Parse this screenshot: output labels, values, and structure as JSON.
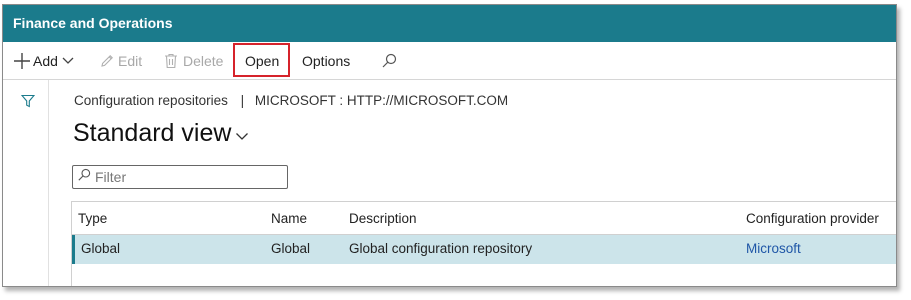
{
  "app": {
    "title": "Finance and Operations"
  },
  "toolbar": {
    "add_label": "Add",
    "edit_label": "Edit",
    "delete_label": "Delete",
    "open_label": "Open",
    "options_label": "Options"
  },
  "breadcrumb": {
    "page": "Configuration repositories",
    "separator": "|",
    "record": "MICROSOFT : HTTP://MICROSOFT.COM"
  },
  "view": {
    "title": "Standard view"
  },
  "filter": {
    "placeholder": "Filter",
    "value": ""
  },
  "grid": {
    "columns": [
      "Type",
      "Name",
      "Description",
      "Configuration provider"
    ],
    "rows": [
      {
        "type": "Global",
        "name": "Global",
        "description": "Global configuration repository",
        "provider": "Microsoft"
      }
    ]
  },
  "colors": {
    "header_bar": "#1b7b8c",
    "selected_row": "#cce4ea",
    "highlight_box": "#d6232b",
    "link": "#1f56a7"
  },
  "icons": {
    "add": "plus-icon",
    "add_menu": "chevron-down-icon",
    "edit": "pencil-icon",
    "delete": "trash-icon",
    "search": "search-icon",
    "filter_pane": "funnel-icon",
    "view_menu": "chevron-down-icon",
    "filter_field": "search-icon"
  }
}
